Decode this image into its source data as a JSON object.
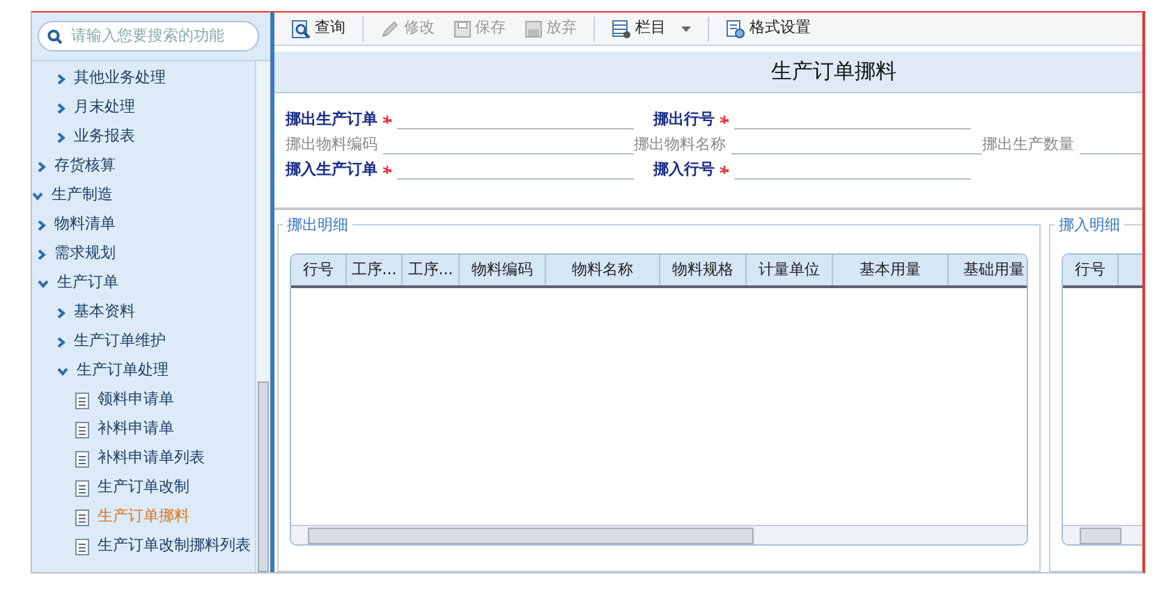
{
  "search": {
    "placeholder": "请输入您要搜索的功能"
  },
  "tree": [
    {
      "children": [
        {
          "children": [
            {
              "kind": "folder",
              "label": "其他业务处理",
              "expanded": false
            },
            {
              "kind": "folder",
              "label": "月末处理",
              "expanded": false
            },
            {
              "kind": "folder",
              "label": "业务报表",
              "expanded": false
            }
          ]
        },
        {
          "kind": "folder",
          "label": "存货核算",
          "expanded": false
        }
      ]
    },
    {
      "kind": "folder",
      "label": "生产制造",
      "expanded": true,
      "children": [
        {
          "kind": "folder",
          "label": "物料清单",
          "expanded": false
        },
        {
          "kind": "folder",
          "label": "需求规划",
          "expanded": false
        },
        {
          "kind": "folder",
          "label": "生产订单",
          "expanded": true,
          "children": [
            {
              "kind": "folder",
              "label": "基本资料",
              "expanded": false
            },
            {
              "kind": "folder",
              "label": "生产订单维护",
              "expanded": false
            },
            {
              "kind": "folder",
              "label": "生产订单处理",
              "expanded": true,
              "children": [
                {
                  "kind": "doc",
                  "label": "领料申请单",
                  "selected": false
                },
                {
                  "kind": "doc",
                  "label": "补料申请单",
                  "selected": false
                },
                {
                  "kind": "doc",
                  "label": "补料申请单列表",
                  "selected": false
                },
                {
                  "kind": "doc",
                  "label": "生产订单改制",
                  "selected": false
                },
                {
                  "kind": "doc",
                  "label": "生产订单挪料",
                  "selected": true
                },
                {
                  "kind": "doc",
                  "label": "生产订单改制挪料列表",
                  "selected": false
                }
              ]
            }
          ]
        }
      ]
    }
  ],
  "toolbar": [
    {
      "kind": "search",
      "label": "查询",
      "disabled": false,
      "separator_after": true
    },
    {
      "kind": "edit",
      "label": "修改",
      "disabled": true,
      "separator_after": false
    },
    {
      "kind": "save",
      "label": "保存",
      "disabled": true,
      "separator_after": false
    },
    {
      "kind": "discard",
      "label": "放弃",
      "disabled": true,
      "separator_after": true
    },
    {
      "kind": "columns",
      "label": "栏目",
      "disabled": false,
      "dropdown": true,
      "separator_after": true
    },
    {
      "kind": "format",
      "label": "格式设置",
      "disabled": false,
      "separator_after": false
    }
  ],
  "form": {
    "title": "生产订单挪料",
    "rows": [
      [
        {
          "label": "挪出生产订单",
          "required": true
        },
        {
          "label": "挪出行号",
          "required": true
        }
      ],
      [
        {
          "label": "挪出物料编码",
          "required": false
        },
        {
          "label": "挪出物料名称",
          "required": false
        },
        {
          "label": "挪出生产数量",
          "required": false
        }
      ],
      [
        {
          "label": "挪入生产订单",
          "required": true
        },
        {
          "label": "挪入行号",
          "required": true
        }
      ]
    ]
  },
  "panels": [
    {
      "title": "挪出明细",
      "columns": [
        "行号",
        "工序...",
        "工序...",
        "物料编码",
        "物料名称",
        "物料规格",
        "计量单位",
        "基本用量",
        "基础用量"
      ]
    },
    {
      "title": "挪入明细",
      "columns": [
        "行号"
      ]
    }
  ]
}
